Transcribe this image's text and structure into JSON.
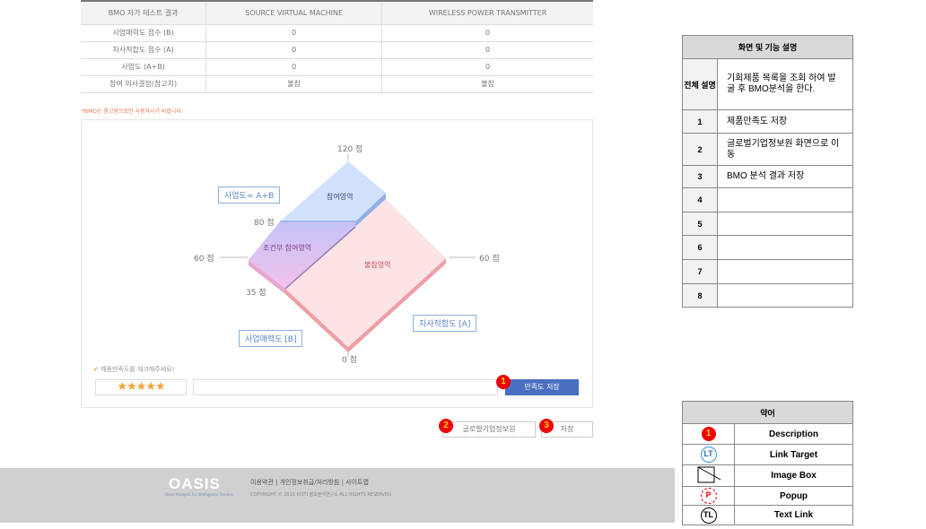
{
  "bmo_table": {
    "headers": [
      "BMO 자가 테스트 결과",
      "SOURCE VIRTUAL MACHINE",
      "WIRELESS POWER TRANSMITTER"
    ],
    "rows": [
      [
        "사업매력도 점수 (B)",
        "0",
        "0"
      ],
      [
        "자사적합도 점수 (A)",
        "0",
        "0"
      ],
      [
        "사업도 (A+B)",
        "0",
        "0"
      ],
      [
        "참여 의사결정(참고치)",
        "불참",
        "불참"
      ]
    ]
  },
  "note": "*BMO는 참고용으로만 사용하시기 바랍니다.",
  "diagram": {
    "top_label": "120 점",
    "label_80": "80 점",
    "left_label": "60 점",
    "right_label": "60 점",
    "label_35": "35 점",
    "bottom_label": "0 점",
    "region_participate": "참여영역",
    "region_conditional": "조건부 참여영역",
    "region_absent": "불참영역",
    "formula": "사업도= A+B",
    "axis_b": "사업매력도 [B]",
    "axis_a": "자사적합도 [A]"
  },
  "satisfaction": {
    "prompt": "제품만족도를 체크해주세요!",
    "rating": 5,
    "max_rating": 5,
    "input_value": "",
    "save_label": "만족도 저장"
  },
  "actions": {
    "global_label": "글로벌기업정보원",
    "save_label": "저장"
  },
  "badges": [
    "1",
    "2",
    "3"
  ],
  "footer": {
    "logo": "OASIS",
    "logo_sub": "Open Analysis for Intelligence Service",
    "links": [
      "이용약관",
      "개인정보취급/처리방침",
      "사이트맵"
    ],
    "copyright": "COPYRIGHT © 2015 KISTI 정보분석연구소 ALL RIGHTS RESERVED."
  },
  "desc_table": {
    "title": "화면 및 기능 설명",
    "overview_label": "전체 설명",
    "overview": "기회제품 목록을 조회 하여 발굴 후 BMO분석을 한다.",
    "rows": [
      {
        "n": "1",
        "text": "제품만족도 저장"
      },
      {
        "n": "2",
        "text": "글로벌기업정보원 화면으로 이동"
      },
      {
        "n": "3",
        "text": "BMO 분석 결과 저장"
      },
      {
        "n": "4",
        "text": ""
      },
      {
        "n": "5",
        "text": ""
      },
      {
        "n": "6",
        "text": ""
      },
      {
        "n": "7",
        "text": ""
      },
      {
        "n": "8",
        "text": ""
      }
    ]
  },
  "legend_table": {
    "title": "약어",
    "rows": [
      {
        "icon": "1",
        "label": "Description"
      },
      {
        "icon": "LT",
        "label": "Link Target"
      },
      {
        "icon": "",
        "label": "Image Box"
      },
      {
        "icon": "P",
        "label": "Popup"
      },
      {
        "icon": "TL",
        "label": "Text Link"
      }
    ]
  },
  "colors": {
    "accent_button": "#4a6fc0",
    "badge": "#e00000",
    "star": "#f5a33b",
    "note": "#e8714c",
    "participate": "#cfe0fa",
    "conditional": "#d7b6f0",
    "absent": "#fde3e3"
  }
}
